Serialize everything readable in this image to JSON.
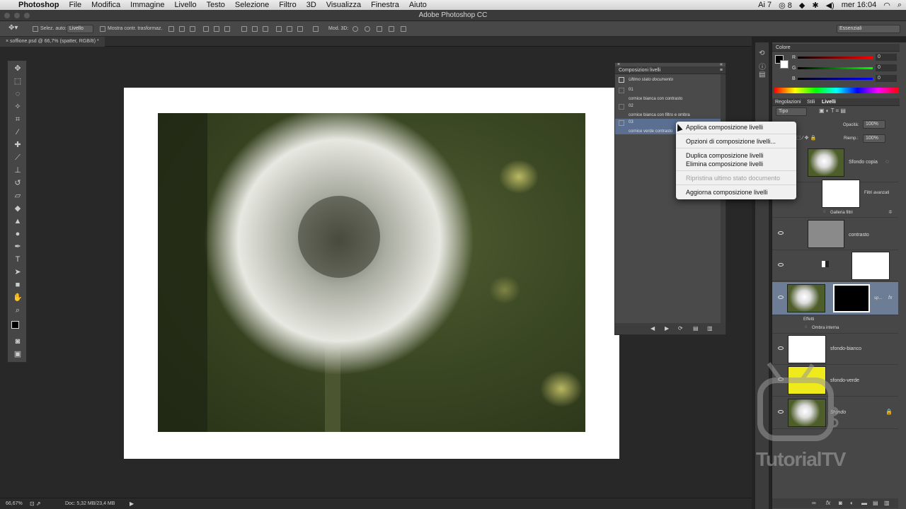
{
  "menubar": {
    "app": "Photoshop",
    "items": [
      "File",
      "Modifica",
      "Immagine",
      "Livello",
      "Testo",
      "Selezione",
      "Filtro",
      "3D",
      "Visualizza",
      "Finestra",
      "Aiuto"
    ],
    "status": {
      "ai": "7",
      "vol": "8",
      "time": "mer 16:04"
    }
  },
  "titlebar": {
    "title": "Adobe Photoshop CC"
  },
  "options": {
    "auto_select_label": "Selez. auto:",
    "auto_select_value": "Livello",
    "transform_label": "Mostra contr. trasformaz.",
    "mode3d_label": "Mod. 3D:",
    "workspace": "Essenziali"
  },
  "document": {
    "tab": "soffione.psd @ 66,7% (spatter, RGB/8) *"
  },
  "statusbar": {
    "zoom": "66,67%",
    "doc": "Doc: 5,32 MB/23,4 MB"
  },
  "color_panel": {
    "title": "Colore",
    "r_label": "R",
    "g_label": "G",
    "b_label": "B",
    "r": "0",
    "g": "0",
    "b": "0"
  },
  "layers_panel": {
    "tabs": [
      "Regolazioni",
      "Stili",
      "Livelli"
    ],
    "kind_filter": "Tipo",
    "opacity_label": "Opacità:",
    "opacity": "100%",
    "fill_label": "Riemp.:",
    "fill": "100%",
    "layers": [
      {
        "name": "Sfondo copia"
      },
      {
        "name": "Filtri avanzati"
      },
      {
        "name": "Galleria filtri"
      },
      {
        "name": "contrasto"
      },
      {
        "name": "sp..."
      },
      {
        "name": "Effetti"
      },
      {
        "name": "Ombra interna"
      },
      {
        "name": "sfondo-bianco"
      },
      {
        "name": "sfondo-verde"
      },
      {
        "name": "Sfondo"
      }
    ]
  },
  "comps_panel": {
    "title": "Composizioni livelli",
    "last_state": "Ultimo stato documento",
    "comps": [
      {
        "name": "01",
        "comment": "cornice bianca con contrasto"
      },
      {
        "name": "02",
        "comment": "cornice bianca con filtro e ombra"
      },
      {
        "name": "03",
        "comment": "cornice verde contrasto"
      }
    ]
  },
  "context_menu": {
    "items": [
      "Applica composizione livelli",
      "Opzioni di composizione livelli...",
      "Duplica composizione livelli",
      "Elimina composizione livelli",
      "Ripristina ultimo stato documento",
      "Aggiorna composizione livelli"
    ]
  },
  "watermark": {
    "text": "TutorialTV"
  }
}
